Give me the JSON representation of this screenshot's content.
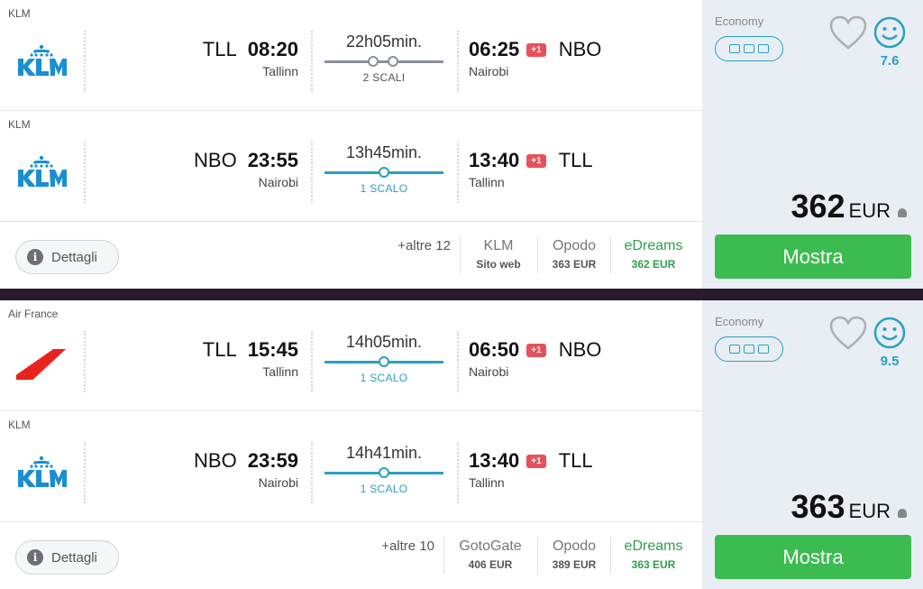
{
  "colors": {
    "accent": "#2aa0c4",
    "green": "#3cbc50",
    "badge": "#e8505b"
  },
  "results": [
    {
      "legs": [
        {
          "airline": "KLM",
          "logo": "klm-logo",
          "dep_code": "TLL",
          "dep_time": "08:20",
          "dep_city": "Tallinn",
          "duration": "22h05min.",
          "stops": "2 SCALI",
          "arr_time": "06:25",
          "plus_day": "+1",
          "arr_code": "NBO",
          "arr_city": "Nairobi"
        },
        {
          "airline": "KLM",
          "logo": "klm-logo",
          "dep_code": "NBO",
          "dep_time": "23:55",
          "dep_city": "Nairobi",
          "duration": "13h45min.",
          "stops": "1 SCALO",
          "arr_time": "13:40",
          "plus_day": "+1",
          "arr_code": "TLL",
          "arr_city": "Tallinn"
        }
      ],
      "details_label": "Dettagli",
      "more_label": "+altre 12",
      "providers": [
        {
          "name": "KLM",
          "price": "Sito web"
        },
        {
          "name": "Opodo",
          "price": "363 EUR"
        },
        {
          "name": "eDreams",
          "price": "362 EUR"
        }
      ],
      "cabin": "Economy",
      "score": "7.6",
      "price": "362",
      "currency": "EUR",
      "cta": "Mostra"
    },
    {
      "legs": [
        {
          "airline": "Air France",
          "logo": "air-france-logo",
          "dep_code": "TLL",
          "dep_time": "15:45",
          "dep_city": "Tallinn",
          "duration": "14h05min.",
          "stops": "1 SCALO",
          "arr_time": "06:50",
          "plus_day": "+1",
          "arr_code": "NBO",
          "arr_city": "Nairobi"
        },
        {
          "airline": "KLM",
          "logo": "klm-logo",
          "dep_code": "NBO",
          "dep_time": "23:59",
          "dep_city": "Nairobi",
          "duration": "14h41min.",
          "stops": "1 SCALO",
          "arr_time": "13:40",
          "plus_day": "+1",
          "arr_code": "TLL",
          "arr_city": "Tallinn"
        }
      ],
      "details_label": "Dettagli",
      "more_label": "+altre 10",
      "providers": [
        {
          "name": "GotoGate",
          "price": "406 EUR"
        },
        {
          "name": "Opodo",
          "price": "389 EUR"
        },
        {
          "name": "eDreams",
          "price": "363 EUR"
        }
      ],
      "cabin": "Economy",
      "score": "9.5",
      "price": "363",
      "currency": "EUR",
      "cta": "Mostra"
    }
  ]
}
